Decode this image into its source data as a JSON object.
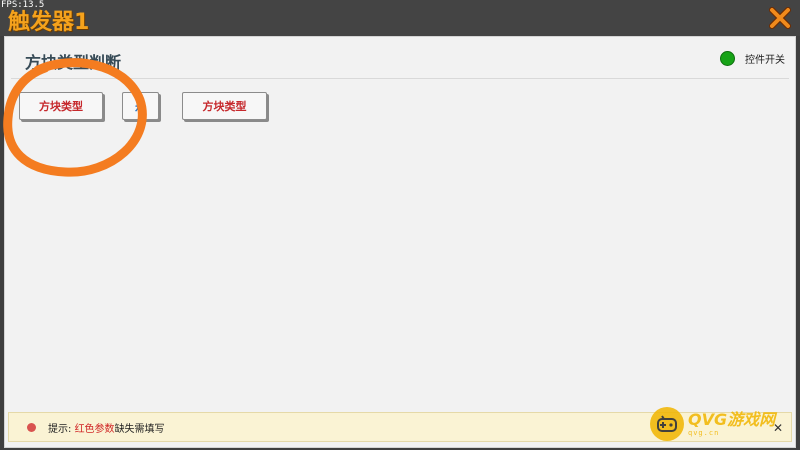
{
  "fps": "FPS:13.5",
  "window": {
    "title": "触发器1"
  },
  "header": {
    "title": "方块类型判断",
    "toggle_label": "控件开关",
    "toggle_color": "#17a317"
  },
  "condition": {
    "left_param": "方块类型",
    "operator": "是",
    "right_param": "方块类型"
  },
  "hint": {
    "prefix": "提示: ",
    "highlight": "红色参数",
    "suffix": "缺失需填写",
    "close_symbol": "✕"
  },
  "watermark": {
    "brand": "QVG游戏网",
    "sub": "qvg.cn"
  },
  "colors": {
    "title_orange": "#f5a21c",
    "param_red": "#c6282c",
    "operator_blue": "#2473c2",
    "annotation_orange": "#f47c20"
  },
  "icons": {
    "close": "close-x-icon",
    "toggle": "toggle-status-icon",
    "hint": "hint-dot-icon",
    "watermark": "gamepad-icon"
  }
}
